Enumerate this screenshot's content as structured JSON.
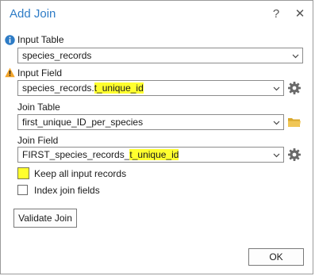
{
  "window": {
    "title": "Add Join",
    "help_label": "?",
    "close_label": "✕"
  },
  "input_table": {
    "label": "Input Table",
    "status": "info",
    "value": "species_records"
  },
  "input_field": {
    "label": "Input Field",
    "status": "warning",
    "value_prefix": "species_records.",
    "value_highlight": "t_unique_id"
  },
  "join_table": {
    "label": "Join Table",
    "value": "first_unique_ID_per_species"
  },
  "join_field": {
    "label": "Join Field",
    "value_prefix": "FIRST_species_records_",
    "value_highlight": "t_unique_id"
  },
  "options": {
    "keep_all": {
      "label": "Keep all input records",
      "checked": false
    },
    "index_join": {
      "label": "Index join fields",
      "checked": false
    }
  },
  "buttons": {
    "validate": "Validate Join",
    "ok": "OK"
  },
  "colors": {
    "title": "#2e7cc6",
    "highlight": "#ffff2e",
    "info_icon": "#2e7cc6",
    "warning_icon": "#f2a52b",
    "folder_icon": "#d9a82c"
  },
  "icons": {
    "info": "info-icon",
    "warning": "warning-icon",
    "gear": "gear-icon",
    "folder": "folder-icon",
    "chevron": "chevron-down-icon"
  }
}
